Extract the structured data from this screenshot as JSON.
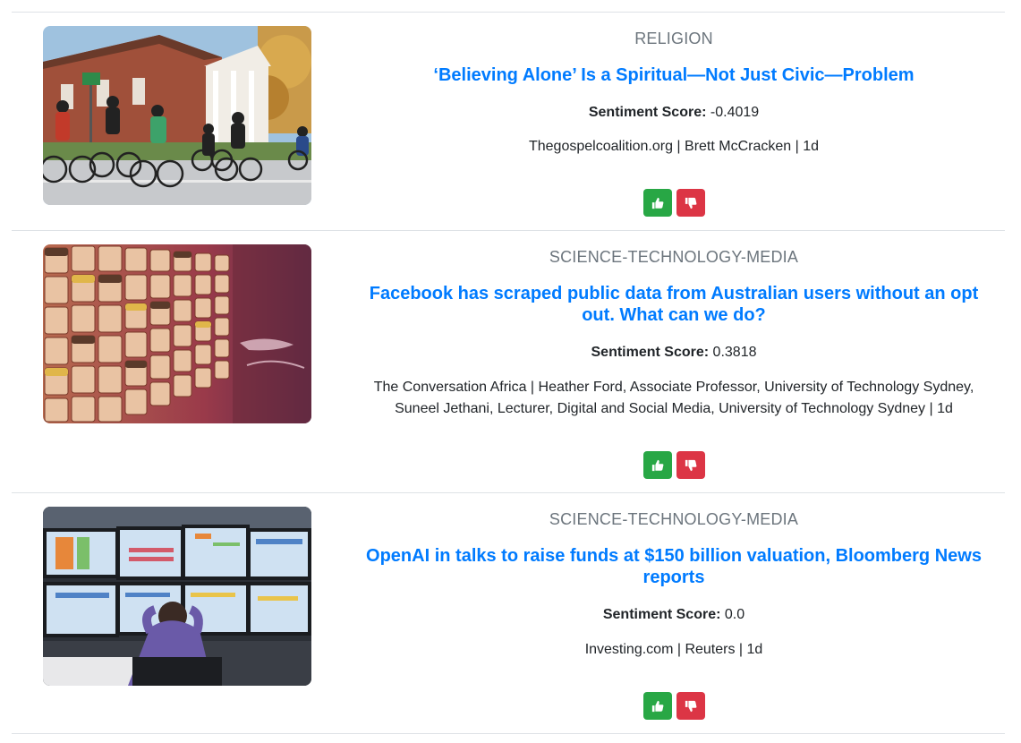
{
  "articles": [
    {
      "category": "RELIGION",
      "title": "‘Believing Alone’ Is a Spiritual—Not Just Civic—Problem",
      "sentiment_label": "Sentiment Score:",
      "sentiment_value": "-0.4019",
      "byline": "Thegospelcoalition.org | Brett McCracken | 1d",
      "image_icon": "church-cyclists-photo"
    },
    {
      "category": "SCIENCE-TECHNOLOGY-MEDIA",
      "title": "Facebook has scraped public data from Australian users without an opt out. What can we do?",
      "sentiment_label": "Sentiment Score:",
      "sentiment_value": "0.3818",
      "byline": "The Conversation Africa | Heather Ford, Associate Professor, University of Technology Sydney, Suneel Jethani, Lecturer, Digital and Social Media, University of Technology Sydney | 1d",
      "image_icon": "faces-wall-photo"
    },
    {
      "category": "SCIENCE-TECHNOLOGY-MEDIA",
      "title": "OpenAI in talks to raise funds at $150 billion valuation, Bloomberg News reports",
      "sentiment_label": "Sentiment Score:",
      "sentiment_value": "0.0",
      "byline": "Investing.com | Reuters | 1d",
      "image_icon": "trading-floor-photo"
    }
  ],
  "icons": {
    "like": "thumbs-up-icon",
    "dislike": "thumbs-down-icon"
  },
  "colors": {
    "link": "#007bff",
    "category": "#6c757d",
    "like": "#28a745",
    "dislike": "#dc3545",
    "divider": "#dee2e6"
  }
}
